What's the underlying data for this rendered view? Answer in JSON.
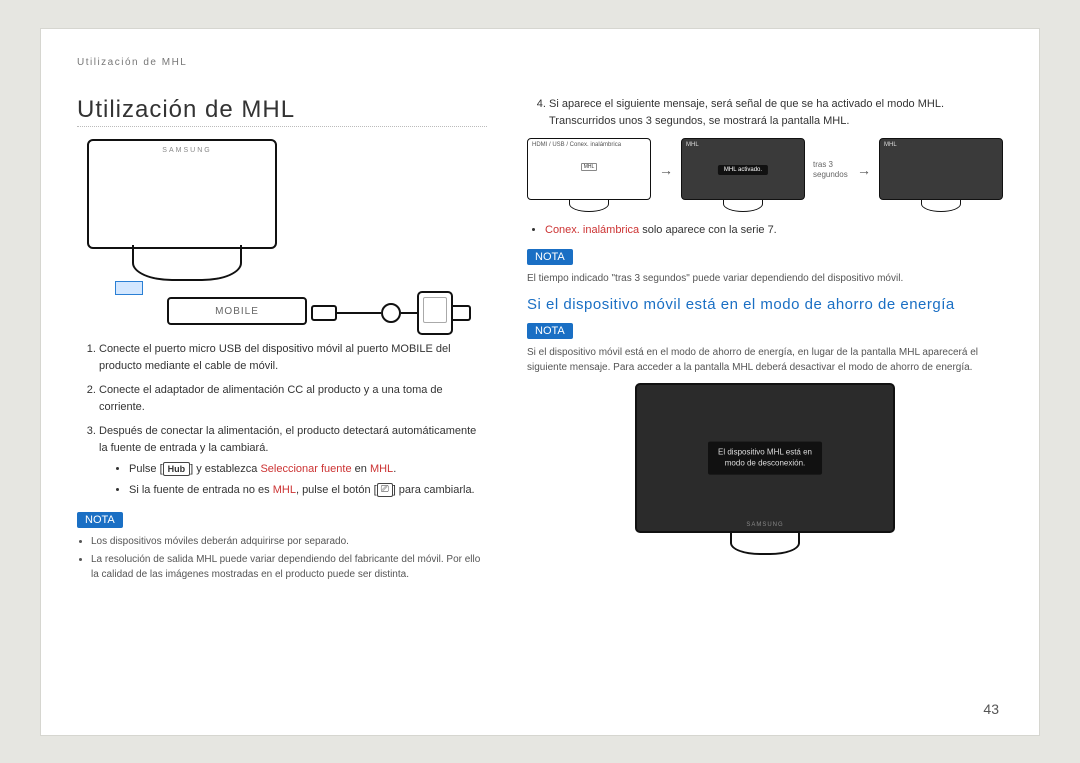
{
  "header": "Utilización de MHL",
  "title": "Utilización de MHL",
  "page_number": "43",
  "left": {
    "mobile_label": "MOBILE",
    "brand": "SAMSUNG",
    "steps": [
      "Conecte el puerto micro USB del dispositivo móvil al puerto MOBILE del producto mediante el cable de móvil.",
      "Conecte el adaptador de alimentación CC al producto y a una toma de corriente.",
      "Después de conectar la alimentación, el producto detectará automáticamente la fuente de entrada y la cambiará."
    ],
    "sub_bullets_prefix": "Pulse [",
    "hub_label": "Hub",
    "sub_bullets_mid1": "] y establezca ",
    "select_source": "Seleccionar fuente",
    "sub_bullets_mid2": " en ",
    "mhl": "MHL",
    "sub_bullet2_a": "Si la fuente de entrada no es ",
    "sub_bullet2_b": ", pulse el botón [",
    "src_icon": "⎚",
    "sub_bullet2_c": "] para cambiarla.",
    "nota": "NOTA",
    "notes": [
      "Los dispositivos móviles deberán adquirirse por separado.",
      "La resolución de salida MHL puede variar dependiendo del fabricante del móvil. Por ello la calidad de las imágenes mostradas en el producto puede ser distinta."
    ]
  },
  "right": {
    "step4": "Si aparece el siguiente mensaje, será señal de que se ha activado el modo MHL. Transcurridos unos 3 segundos, se mostrará la pantalla MHL.",
    "mini1_text": "HDMI / USB / Conex. inalámbrica",
    "mini1_center_badge": "MHL",
    "mini2_corner": "MHL",
    "mini2_msg": "MHL activado.",
    "tras": "tras 3 segundos",
    "mini3_corner": "MHL",
    "bullet_conex_a": "Conex. inalámbrica",
    "bullet_conex_b": " solo aparece con la serie 7.",
    "nota": "NOTA",
    "note_time": "El tiempo indicado \"tras 3 segundos\" puede variar dependiendo del dispositivo móvil.",
    "h2": "Si el dispositivo móvil está en el modo de ahorro de energía",
    "note_sleep": "Si el dispositivo móvil está en el modo de ahorro de energía, en lugar de la pantalla MHL aparecerá el siguiente mensaje. Para acceder a la pantalla MHL deberá desactivar el modo de ahorro de energía.",
    "sleep_msg_l1": "El dispositivo MHL está en",
    "sleep_msg_l2": "modo de desconexión."
  }
}
